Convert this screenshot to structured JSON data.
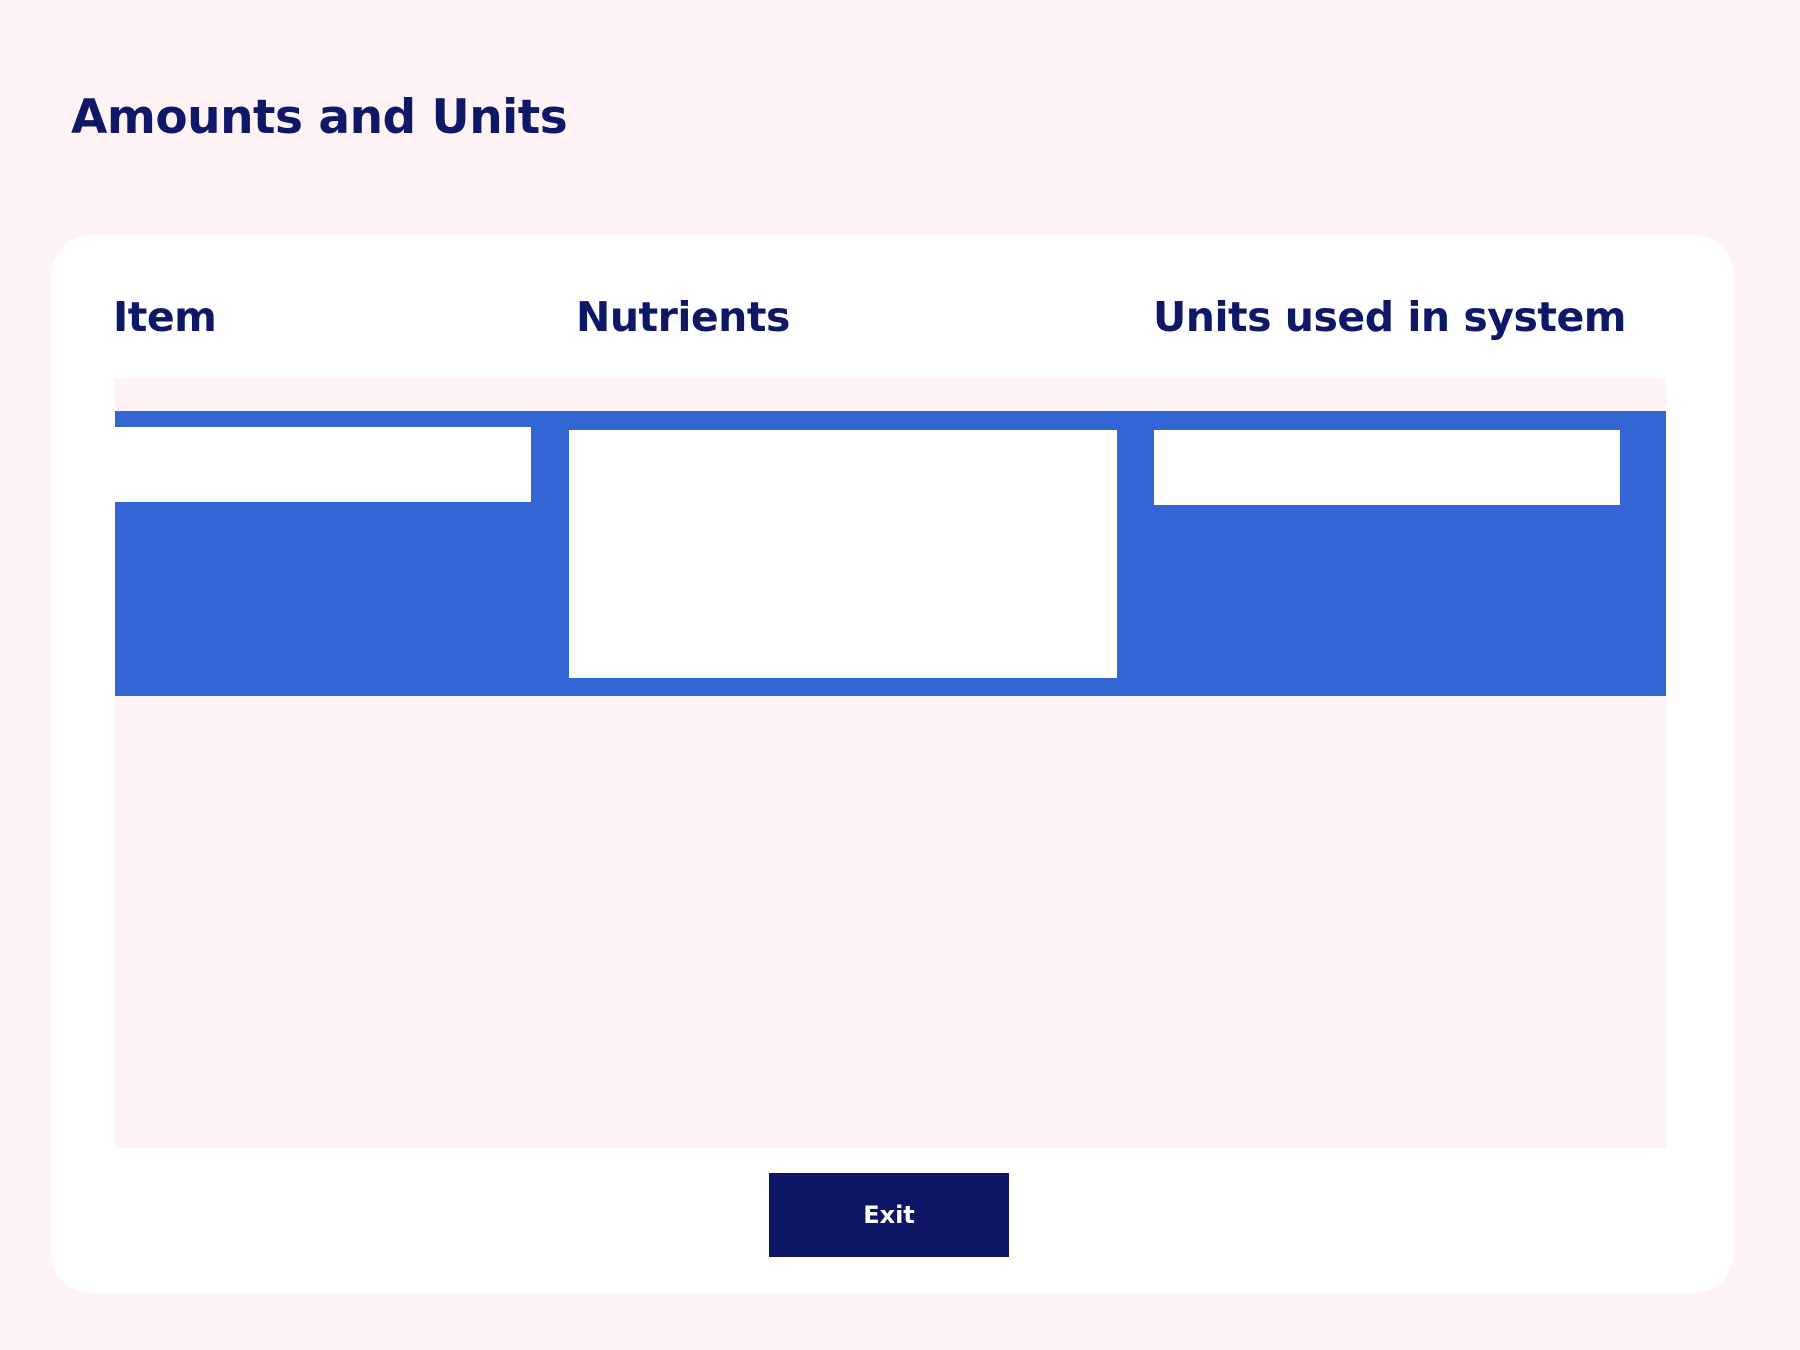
{
  "page": {
    "title": "Amounts and Units",
    "background_color": "#fff3f6",
    "card_color": "#ffffff",
    "accent_color": "#3366d4",
    "text_color": "#0f1866"
  },
  "table": {
    "columns": [
      {
        "label": "Item"
      },
      {
        "label": "Nutrients"
      },
      {
        "label": "Units used in system"
      }
    ],
    "rows": [
      {
        "item": "",
        "nutrients": "",
        "units": ""
      }
    ]
  },
  "actions": {
    "exit_label": "Exit",
    "exit_color": "#0d1665"
  }
}
